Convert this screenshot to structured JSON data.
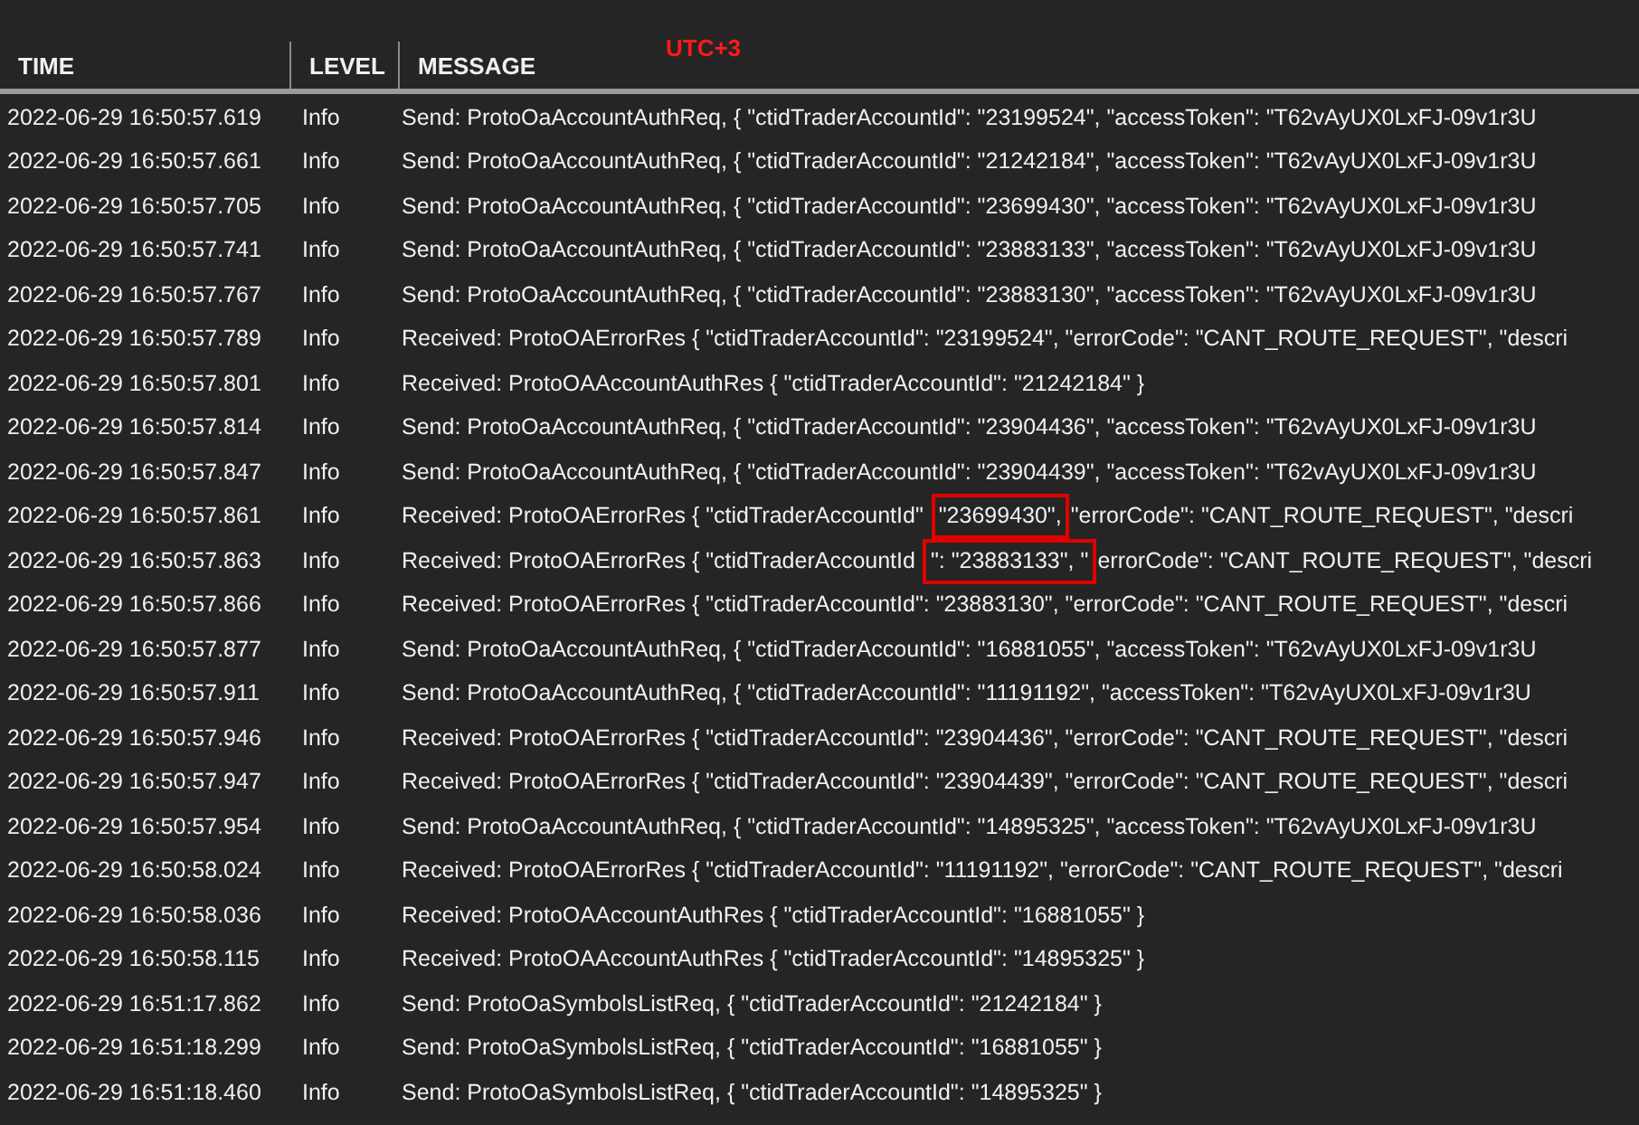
{
  "annotation": "UTC+3",
  "columns": [
    "TIME",
    "LEVEL",
    "MESSAGE"
  ],
  "rows": [
    {
      "time": "2022-06-29 16:50:57.619",
      "level": "Info",
      "message": [
        {
          "text": "Send: ProtoOaAccountAuthReq, { \"ctidTraderAccountId\": \"23199524\", \"accessToken\": \"T62vAyUX0LxFJ-09v1r3U",
          "boxed": false
        }
      ]
    },
    {
      "time": "2022-06-29 16:50:57.661",
      "level": "Info",
      "message": [
        {
          "text": "Send: ProtoOaAccountAuthReq, { \"ctidTraderAccountId\": \"21242184\", \"accessToken\": \"T62vAyUX0LxFJ-09v1r3U",
          "boxed": false
        }
      ]
    },
    {
      "time": "2022-06-29 16:50:57.705",
      "level": "Info",
      "message": [
        {
          "text": "Send: ProtoOaAccountAuthReq, { \"ctidTraderAccountId\": \"23699430\", \"accessToken\": \"T62vAyUX0LxFJ-09v1r3U",
          "boxed": false
        }
      ]
    },
    {
      "time": "2022-06-29 16:50:57.741",
      "level": "Info",
      "message": [
        {
          "text": "Send: ProtoOaAccountAuthReq, { \"ctidTraderAccountId\": \"23883133\", \"accessToken\": \"T62vAyUX0LxFJ-09v1r3U",
          "boxed": false
        }
      ]
    },
    {
      "time": "2022-06-29 16:50:57.767",
      "level": "Info",
      "message": [
        {
          "text": "Send: ProtoOaAccountAuthReq, { \"ctidTraderAccountId\": \"23883130\", \"accessToken\": \"T62vAyUX0LxFJ-09v1r3U",
          "boxed": false
        }
      ]
    },
    {
      "time": "2022-06-29 16:50:57.789",
      "level": "Info",
      "message": [
        {
          "text": "Received: ProtoOAErrorRes { \"ctidTraderAccountId\": \"23199524\", \"errorCode\": \"CANT_ROUTE_REQUEST\", \"descri",
          "boxed": false
        }
      ]
    },
    {
      "time": "2022-06-29 16:50:57.801",
      "level": "Info",
      "message": [
        {
          "text": "Received: ProtoOAAccountAuthRes { \"ctidTraderAccountId\": \"21242184\" }",
          "boxed": false
        }
      ]
    },
    {
      "time": "2022-06-29 16:50:57.814",
      "level": "Info",
      "message": [
        {
          "text": "Send: ProtoOaAccountAuthReq, { \"ctidTraderAccountId\": \"23904436\", \"accessToken\": \"T62vAyUX0LxFJ-09v1r3U",
          "boxed": false
        }
      ]
    },
    {
      "time": "2022-06-29 16:50:57.847",
      "level": "Info",
      "message": [
        {
          "text": "Send: ProtoOaAccountAuthReq, { \"ctidTraderAccountId\": \"23904439\", \"accessToken\": \"T62vAyUX0LxFJ-09v1r3U",
          "boxed": false
        }
      ]
    },
    {
      "time": "2022-06-29 16:50:57.861",
      "level": "Info",
      "message": [
        {
          "text": "Received: ProtoOAErrorRes { \"ctidTraderAccountId\"",
          "boxed": false
        },
        {
          "text": "\"23699430\",",
          "boxed": true
        },
        {
          "text": "\"errorCode\": \"CANT_ROUTE_REQUEST\", \"descri",
          "boxed": false
        }
      ]
    },
    {
      "time": "2022-06-29 16:50:57.863",
      "level": "Info",
      "message": [
        {
          "text": "Received: ProtoOAErrorRes { \"ctidTraderAccountId",
          "boxed": false
        },
        {
          "text": "\": \"23883133\", \"",
          "boxed": true
        },
        {
          "text": "errorCode\": \"CANT_ROUTE_REQUEST\", \"descri",
          "boxed": false
        }
      ]
    },
    {
      "time": "2022-06-29 16:50:57.866",
      "level": "Info",
      "message": [
        {
          "text": "Received: ProtoOAErrorRes { \"ctidTraderAccountId\": \"23883130\", \"errorCode\": \"CANT_ROUTE_REQUEST\", \"descri",
          "boxed": false
        }
      ]
    },
    {
      "time": "2022-06-29 16:50:57.877",
      "level": "Info",
      "message": [
        {
          "text": "Send: ProtoOaAccountAuthReq, { \"ctidTraderAccountId\": \"16881055\", \"accessToken\": \"T62vAyUX0LxFJ-09v1r3U",
          "boxed": false
        }
      ]
    },
    {
      "time": "2022-06-29 16:50:57.911",
      "level": "Info",
      "message": [
        {
          "text": "Send: ProtoOaAccountAuthReq, { \"ctidTraderAccountId\": \"11191192\", \"accessToken\": \"T62vAyUX0LxFJ-09v1r3U",
          "boxed": false
        }
      ]
    },
    {
      "time": "2022-06-29 16:50:57.946",
      "level": "Info",
      "message": [
        {
          "text": "Received: ProtoOAErrorRes { \"ctidTraderAccountId\": \"23904436\", \"errorCode\": \"CANT_ROUTE_REQUEST\", \"descri",
          "boxed": false
        }
      ]
    },
    {
      "time": "2022-06-29 16:50:57.947",
      "level": "Info",
      "message": [
        {
          "text": "Received: ProtoOAErrorRes { \"ctidTraderAccountId\": \"23904439\", \"errorCode\": \"CANT_ROUTE_REQUEST\", \"descri",
          "boxed": false
        }
      ]
    },
    {
      "time": "2022-06-29 16:50:57.954",
      "level": "Info",
      "message": [
        {
          "text": "Send: ProtoOaAccountAuthReq, { \"ctidTraderAccountId\": \"14895325\", \"accessToken\": \"T62vAyUX0LxFJ-09v1r3U",
          "boxed": false
        }
      ]
    },
    {
      "time": "2022-06-29 16:50:58.024",
      "level": "Info",
      "message": [
        {
          "text": "Received: ProtoOAErrorRes { \"ctidTraderAccountId\": \"11191192\", \"errorCode\": \"CANT_ROUTE_REQUEST\", \"descri",
          "boxed": false
        }
      ]
    },
    {
      "time": "2022-06-29 16:50:58.036",
      "level": "Info",
      "message": [
        {
          "text": "Received: ProtoOAAccountAuthRes { \"ctidTraderAccountId\": \"16881055\" }",
          "boxed": false
        }
      ]
    },
    {
      "time": "2022-06-29 16:50:58.115",
      "level": "Info",
      "message": [
        {
          "text": "Received: ProtoOAAccountAuthRes { \"ctidTraderAccountId\": \"14895325\" }",
          "boxed": false
        }
      ]
    },
    {
      "time": "2022-06-29 16:51:17.862",
      "level": "Info",
      "message": [
        {
          "text": "Send: ProtoOaSymbolsListReq, { \"ctidTraderAccountId\": \"21242184\" }",
          "boxed": false
        }
      ]
    },
    {
      "time": "2022-06-29 16:51:18.299",
      "level": "Info",
      "message": [
        {
          "text": "Send: ProtoOaSymbolsListReq, { \"ctidTraderAccountId\": \"16881055\" }",
          "boxed": false
        }
      ]
    },
    {
      "time": "2022-06-29 16:51:18.460",
      "level": "Info",
      "message": [
        {
          "text": "Send: ProtoOaSymbolsListReq, { \"ctidTraderAccountId\": \"14895325\" }",
          "boxed": false
        }
      ]
    }
  ]
}
